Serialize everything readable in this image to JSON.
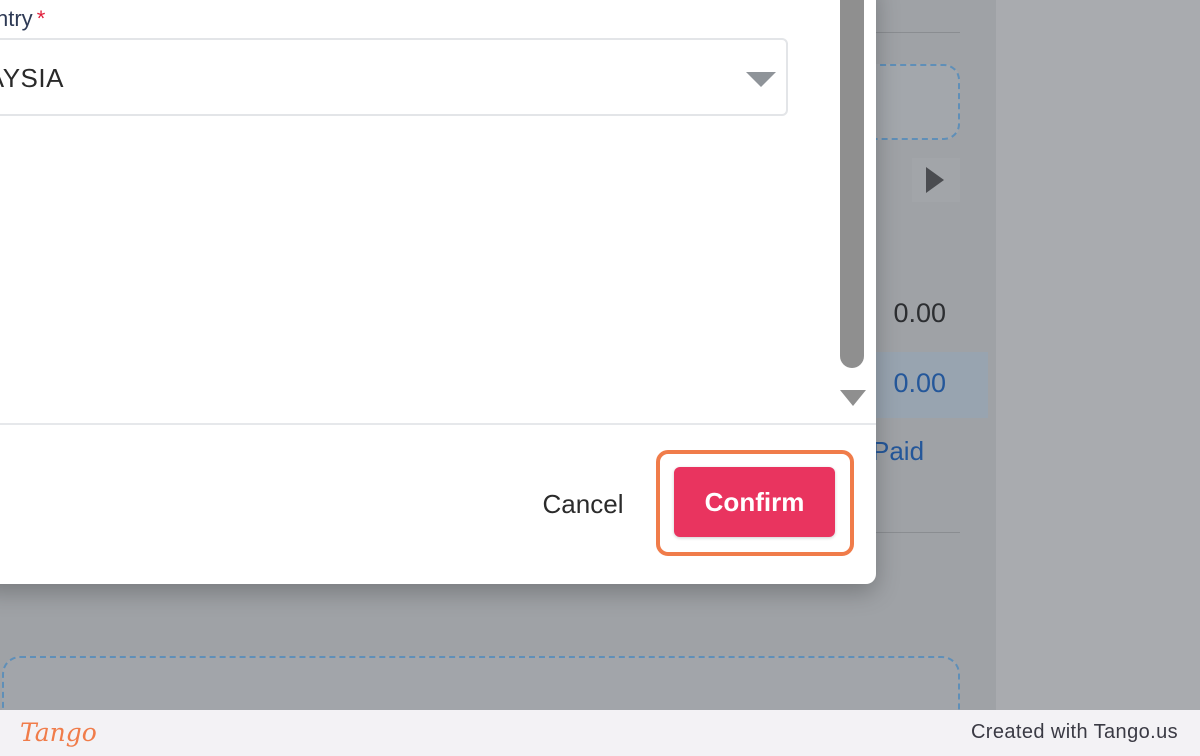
{
  "background": {
    "amount_1": "0.00",
    "amount_2": "0.00",
    "paid_link_partial": "Paid"
  },
  "modal": {
    "country_label_partial": "ntry",
    "required_marker": "*",
    "country_value_partial": "ALAYSIA",
    "cancel_label": "Cancel",
    "confirm_label": "Confirm"
  },
  "footer": {
    "logo": "Tango",
    "credit": "Created with Tango.us"
  },
  "colors": {
    "confirm_bg": "#e9345f",
    "highlight": "#f07c4a",
    "overlay": "#9b9ea2",
    "link": "#24579a"
  }
}
